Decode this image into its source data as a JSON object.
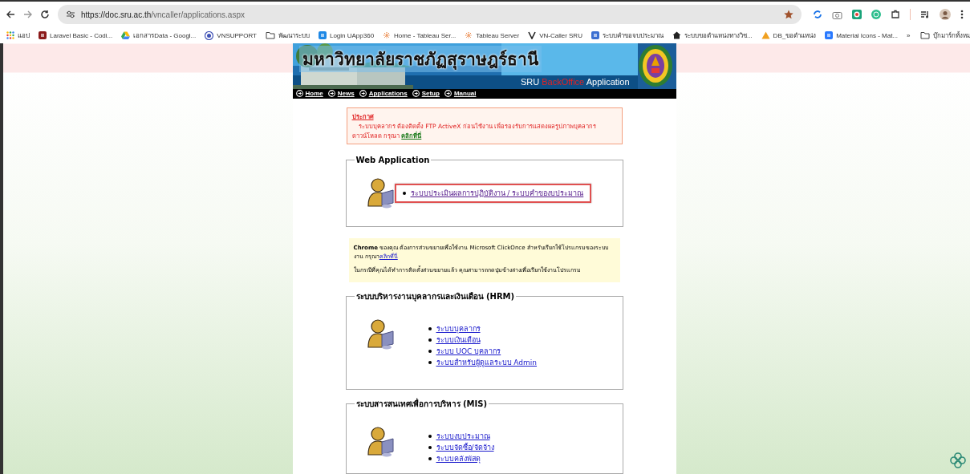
{
  "browser": {
    "url_host": "https://doc.sru.ac.th",
    "url_path": "/vncaller/applications.aspx",
    "bookmarks": [
      {
        "label": "แอป",
        "kind": "apps"
      },
      {
        "label": "Laravel Basic - Codi...",
        "kind": "square"
      },
      {
        "label": "เอกสารData - Googl...",
        "kind": "drive"
      },
      {
        "label": "VNSUPPORT",
        "kind": "vn"
      },
      {
        "label": "พัฒนาระบบ",
        "kind": "folder"
      },
      {
        "label": "Login UApp360",
        "kind": "globe"
      },
      {
        "label": "Home - Tableau Ser...",
        "kind": "tableau"
      },
      {
        "label": "Tableau Server",
        "kind": "tableau"
      },
      {
        "label": "VN-Caller SRU",
        "kind": "v"
      },
      {
        "label": "ระบบคำขอจบประมาณ",
        "kind": "mis"
      },
      {
        "label": "ระบบขอตำแหน่งทางวิช...",
        "kind": "home"
      },
      {
        "label": "DB_ขอตำแหน่ง",
        "kind": "db"
      },
      {
        "label": "Material Icons - Mat...",
        "kind": "mi"
      }
    ],
    "overflow": "»",
    "all_bookmarks": "บุ๊กมาร์กทั้งหม"
  },
  "header": {
    "title": "มหาวิทยาลัยราชภัฏสุราษฎร์ธานี",
    "subtitle": [
      "SRU",
      "BackOffice",
      "Application"
    ],
    "nav": [
      "Home",
      "News",
      "Applications",
      "Setup",
      "Manual"
    ]
  },
  "announcement": {
    "heading": "ประกาศ",
    "text": "ระบบบุคลากร ต้องติดตั้ง FTP ActiveX ก่อนใช้งาน เพื่อรองรับการแสดงผลรูปภาพบุคลากร",
    "download": "ดาวน์โหลด กรุณา",
    "link": "คลิกที่นี่"
  },
  "sections": [
    {
      "legend": "Web Application",
      "links": [
        {
          "label": "ระบบประเมินผลการปฏิบัติงาน / ระบบคำของบประมาณ",
          "highlighted": true
        }
      ]
    },
    {
      "legend": "ระบบบริหารงานบุคลากรและเงินเดือน (HRM)",
      "links": [
        {
          "label": "ระบบบุคลากร",
          "highlighted": false
        },
        {
          "label": "ระบบเงินเดือน",
          "highlighted": false
        },
        {
          "label": "ระบบ UOC บุคลากร",
          "highlighted": false
        },
        {
          "label": "ระบบสำหรับผู้ดูแลระบบ Admin",
          "highlighted": false
        }
      ]
    },
    {
      "legend": "ระบบสารสนเทศเพื่อการบริหาร (MIS)",
      "links": [
        {
          "label": "ระบบงบประมาณ",
          "highlighted": false
        },
        {
          "label": "ระบบจัดซื้อ/จัดจ้าง",
          "highlighted": false
        },
        {
          "label": "ระบบคลังพัสดุ",
          "highlighted": false
        }
      ]
    }
  ],
  "clickonce": {
    "text": "**Chrome** ของคุณ ต้องการส่วนขยายเพื่อใช้งาน Microsoft ClickOnce สำหรับเรียกใช้โปรแกรมของระบบงาน กรุณา",
    "link": "คลิกที่นี่",
    "note": "ในกรณีที่คุณได้ทำการติดตั้งส่วนขยายแล้ว คุณสามารถกดปุ่มข้างล่างเพื่อเรียกใช้งานโปรแกรม"
  }
}
